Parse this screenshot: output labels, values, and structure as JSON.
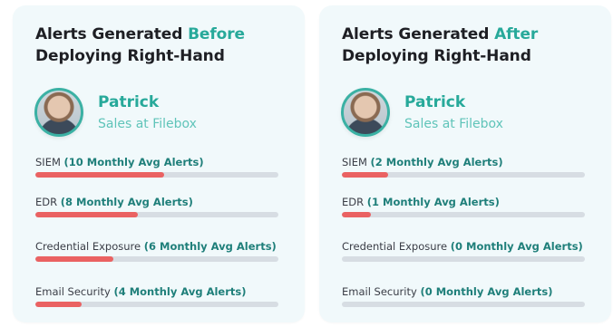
{
  "colors": {
    "card_bg": "#f1f9fb",
    "accent": "#27a99a",
    "bar_fill": "#ea6262",
    "bar_track": "#d7dde3",
    "count_text": "#1f7f7a"
  },
  "cards": [
    {
      "title_pre": "Alerts Generated ",
      "title_accent": "Before",
      "title_post": "Deploying Right-Hand",
      "person": {
        "name": "Patrick",
        "role": "Sales at Filebox"
      },
      "metrics": [
        {
          "label": "SIEM",
          "count": "(10 Monthly Avg Alerts)",
          "level": 0.53
        },
        {
          "label": "EDR",
          "count": "(8 Monthly Avg Alerts)",
          "level": 0.42
        },
        {
          "label": "Credential Exposure",
          "count": "(6 Monthly Avg Alerts)",
          "level": 0.32
        },
        {
          "label": "Email Security",
          "count": "(4 Monthly Avg Alerts)",
          "level": 0.19
        }
      ]
    },
    {
      "title_pre": "Alerts Generated ",
      "title_accent": "After",
      "title_post": "Deploying Right-Hand",
      "person": {
        "name": "Patrick",
        "role": "Sales at Filebox"
      },
      "metrics": [
        {
          "label": "SIEM",
          "count": "(2 Monthly Avg Alerts)",
          "level": 0.19
        },
        {
          "label": "EDR",
          "count": "(1 Monthly Avg Alerts)",
          "level": 0.12
        },
        {
          "label": "Credential Exposure",
          "count": "(0 Monthly Avg Alerts)",
          "level": 0
        },
        {
          "label": "Email Security",
          "count": "(0 Monthly Avg Alerts)",
          "level": 0
        }
      ]
    }
  ]
}
